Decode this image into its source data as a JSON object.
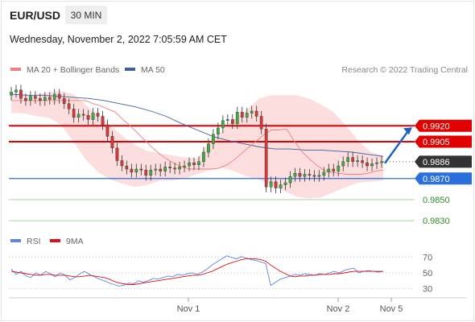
{
  "header": {
    "symbol": "EUR/USD",
    "timeframe": "30 MIN",
    "timestamp": "Wednesday, November 2, 2022 7:05:59 AM CET"
  },
  "legend": {
    "ma20_label": "MA 20 + Bollinger Bands",
    "ma50_label": "MA 50",
    "research": "Research © 2022 Trading Central",
    "rsi_label": "RSI",
    "ma9_label": "9MA"
  },
  "colors": {
    "ma20": "#f08080",
    "bollinger": "#fbd6d6",
    "ma50": "#3f5f9f",
    "bull": "#3fae3f",
    "bear": "#d23a3a",
    "resistance": "#e00000",
    "support_blue": "#2a6fdb",
    "support_green": "#2e8b2e",
    "support_line_green": "#a8d5a0",
    "current": "#333333",
    "rsi": "#5b86e5",
    "rsi_ma": "#dd1111",
    "arrow": "#1f5fbf"
  },
  "chart_data": [
    {
      "type": "candlestick",
      "title": "EUR/USD",
      "timeframe": "30 MIN",
      "x_tick_labels": [
        "Nov 1",
        "Nov 2",
        "Nov 5"
      ],
      "price_levels": [
        {
          "label": "0.9920",
          "value": 0.992,
          "kind": "resistance"
        },
        {
          "label": "0.9905",
          "value": 0.9905,
          "kind": "resistance"
        },
        {
          "label": "0.9886",
          "value": 0.9886,
          "kind": "current"
        },
        {
          "label": "0.9870",
          "value": 0.987,
          "kind": "pivot"
        },
        {
          "label": "0.9850",
          "value": 0.985,
          "kind": "support"
        },
        {
          "label": "0.9830",
          "value": 0.983,
          "kind": "support"
        }
      ],
      "ylim": [
        0.9824,
        0.9963
      ],
      "close_series": [
        0.9952,
        0.9954,
        0.9946,
        0.9944,
        0.9948,
        0.9946,
        0.9944,
        0.9947,
        0.9945,
        0.995,
        0.9946,
        0.9941,
        0.9936,
        0.9928,
        0.9931,
        0.993,
        0.9926,
        0.9932,
        0.9929,
        0.9921,
        0.991,
        0.9899,
        0.9887,
        0.9882,
        0.9879,
        0.9876,
        0.9879,
        0.9878,
        0.9873,
        0.9878,
        0.9879,
        0.9877,
        0.9881,
        0.988,
        0.9879,
        0.9881,
        0.9882,
        0.9885,
        0.9883,
        0.9886,
        0.9895,
        0.9903,
        0.9912,
        0.9918,
        0.9925,
        0.9926,
        0.9922,
        0.9933,
        0.9928,
        0.9932,
        0.9934,
        0.9929,
        0.9917,
        0.9862,
        0.9867,
        0.9861,
        0.9864,
        0.9866,
        0.9872,
        0.9875,
        0.9872,
        0.9874,
        0.9873,
        0.9872,
        0.9873,
        0.9876,
        0.9879,
        0.9877,
        0.9882,
        0.9886,
        0.989,
        0.9886,
        0.9887,
        0.9885,
        0.9882,
        0.9884,
        0.9885,
        0.9886
      ],
      "ma20_series": [
        0.9944,
        0.9944,
        0.9944,
        0.9944,
        0.9944,
        0.9944,
        0.9944,
        0.9944,
        0.9944,
        0.9944,
        0.9944,
        0.9941,
        0.9939,
        0.9936,
        0.9933,
        0.9926,
        0.992,
        0.9913,
        0.9906,
        0.9899,
        0.9893,
        0.9888,
        0.9884,
        0.9881,
        0.9879,
        0.9879,
        0.9879,
        0.9879,
        0.988,
        0.9883,
        0.9888,
        0.9894,
        0.99,
        0.9906,
        0.9912,
        0.9916,
        0.9916,
        0.9917,
        0.9906,
        0.9896,
        0.9889,
        0.9883,
        0.9878,
        0.9876,
        0.9875,
        0.9874,
        0.9874,
        0.9874,
        0.9875,
        0.9877,
        0.9878
      ],
      "ma50_series": [
        0.995,
        0.9949,
        0.9949,
        0.9948,
        0.9947,
        0.9946,
        0.9944,
        0.9941,
        0.9938,
        0.9934,
        0.9929,
        0.9922,
        0.9916,
        0.991,
        0.9906,
        0.9903,
        0.99,
        0.9898,
        0.9898,
        0.9897,
        0.9897,
        0.9896,
        0.9895,
        0.9893,
        0.9891
      ],
      "bb_upper_series": [
        0.9949,
        0.9949,
        0.9949,
        0.9952,
        0.9953,
        0.995,
        0.994,
        0.993,
        0.992,
        0.991,
        0.9902,
        0.9896,
        0.9894,
        0.9892,
        0.989,
        0.9889,
        0.9905,
        0.9915,
        0.9927,
        0.9935,
        0.9946,
        0.9949,
        0.9949,
        0.9949,
        0.9946,
        0.994,
        0.9933,
        0.992,
        0.9906,
        0.9895,
        0.9892
      ],
      "bb_lower_series": [
        0.9932,
        0.9932,
        0.9929,
        0.9928,
        0.9921,
        0.9905,
        0.9888,
        0.9876,
        0.9869,
        0.9865,
        0.9862,
        0.9864,
        0.9868,
        0.9868,
        0.987,
        0.9874,
        0.9878,
        0.988,
        0.9877,
        0.9872,
        0.9869,
        0.9864,
        0.9858,
        0.9853,
        0.9851,
        0.9852,
        0.9857,
        0.9862,
        0.9866,
        0.9867,
        0.9868
      ]
    },
    {
      "type": "line",
      "title": "RSI",
      "yticks": [
        70,
        50,
        30
      ],
      "ylim": [
        20,
        80
      ],
      "series": [
        {
          "name": "RSI",
          "values": [
            55,
            48,
            52,
            46,
            44,
            50,
            47,
            52,
            49,
            45,
            50,
            47,
            41,
            44,
            49,
            52,
            48,
            45,
            42,
            40,
            37,
            35,
            33,
            34,
            37,
            36,
            40,
            38,
            40,
            43,
            42,
            44,
            46,
            45,
            48,
            47,
            49,
            50,
            48,
            51,
            55,
            60,
            64,
            68,
            72,
            70,
            68,
            71,
            69,
            67,
            66,
            64,
            62,
            34,
            38,
            42,
            44,
            46,
            48,
            47,
            49,
            48,
            47,
            49,
            48,
            50,
            52,
            50,
            53,
            55,
            56,
            50,
            52,
            53,
            52,
            51,
            52
          ]
        },
        {
          "name": "9MA",
          "values": [
            52,
            51,
            50,
            49,
            48,
            47,
            47,
            48,
            48,
            47,
            47,
            47,
            46,
            45,
            45,
            46,
            47,
            46,
            45,
            44,
            42,
            39,
            37,
            36,
            35,
            35,
            36,
            37,
            38,
            39,
            40,
            41,
            42,
            43,
            44,
            45,
            46,
            47,
            47,
            48,
            50,
            52,
            55,
            58,
            61,
            63,
            65,
            67,
            68,
            68,
            68,
            67,
            65,
            60,
            56,
            52,
            49,
            46,
            45,
            46,
            46,
            47,
            47,
            48,
            48,
            48,
            49,
            49,
            50,
            51,
            52,
            52,
            52,
            52,
            52,
            52,
            52
          ]
        }
      ]
    }
  ]
}
